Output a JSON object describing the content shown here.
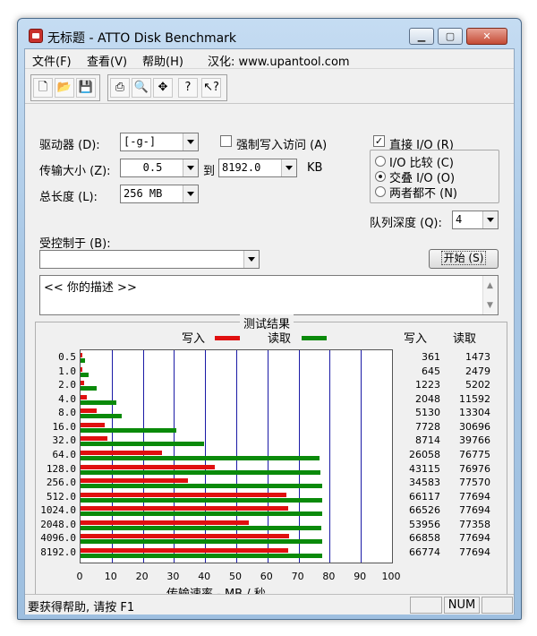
{
  "window": {
    "title": "无标题 - ATTO Disk Benchmark"
  },
  "menu": {
    "file": "文件(F)",
    "view": "查看(V)",
    "help": "帮助(H)",
    "credit": "汉化: www.upantool.com"
  },
  "form": {
    "drive_label": "驱动器 (D):",
    "drive_value": "[-g-]",
    "force_write_label": "强制写入访问 (A)",
    "direct_io_label": "直接 I/O (R)",
    "direct_io_checked": true,
    "transfer_label": "传输大小 (Z):",
    "transfer_from": "0.5",
    "to_label": "到",
    "transfer_to": "8192.0",
    "kb_label": "KB",
    "io_compare": "I/O 比较 (C)",
    "overlapped_io": "交叠 I/O (O)",
    "neither": "两者都不 (N)",
    "selected_io_mode": "overlapped",
    "total_length_label": "总长度 (L):",
    "total_length_value": "256 MB",
    "queue_depth_label": "队列深度 (Q):",
    "queue_depth_value": "4",
    "controlled_by_label": "受控制于 (B):",
    "controlled_by_value": "",
    "start_button": "开始 (S)",
    "description_text": "<<  你的描述   >>"
  },
  "results": {
    "group_title": "测试结果",
    "legend_write": "写入",
    "legend_read": "读取",
    "col_write": "写入",
    "col_read": "读取"
  },
  "chart_data": {
    "type": "bar",
    "orientation": "horizontal",
    "title": "测试结果",
    "xlabel": "传输速率 - MB / 秒",
    "ylabel": "",
    "xlim": [
      0,
      100
    ],
    "xticks": [
      "0",
      "10",
      "20",
      "30",
      "40",
      "50",
      "60",
      "70",
      "80",
      "90",
      "100"
    ],
    "categories": [
      "0.5",
      "1.0",
      "2.0",
      "4.0",
      "8.0",
      "16.0",
      "32.0",
      "64.0",
      "128.0",
      "256.0",
      "512.0",
      "1024.0",
      "2048.0",
      "4096.0",
      "8192.0"
    ],
    "series": [
      {
        "name": "写入",
        "color": "#e01010",
        "values": [
          361,
          645,
          1223,
          2048,
          5130,
          7728,
          8714,
          26058,
          43115,
          34583,
          66117,
          66526,
          53956,
          66858,
          66774
        ]
      },
      {
        "name": "读取",
        "color": "#0a8a0a",
        "values": [
          1473,
          2479,
          5202,
          11592,
          13304,
          30696,
          39766,
          76775,
          76976,
          77570,
          77694,
          77694,
          77358,
          77694,
          77694
        ]
      }
    ]
  },
  "status": {
    "help": "要获得帮助, 请按 F1",
    "num": "NUM"
  },
  "colors": {
    "write": "#e01010",
    "read": "#0a8a0a",
    "grid": "#1a1aa6"
  }
}
